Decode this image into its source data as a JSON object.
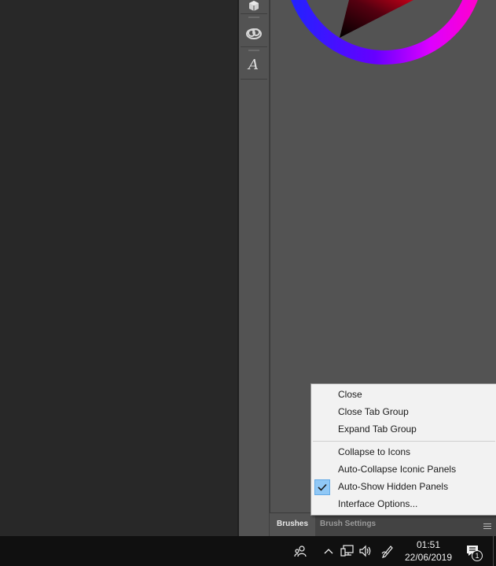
{
  "colors": {
    "canvas_bg": "#282828",
    "panel_bg": "#535353",
    "tab_inactive_bg": "#434343",
    "menu_bg": "#f2f2f2",
    "menu_check_bg": "#90c8f6",
    "taskbar_bg": "#101010"
  },
  "icon_strip": {
    "items": [
      {
        "icon": "3d-cube-icon"
      },
      {
        "icon": "creative-cloud-libraries-icon"
      },
      {
        "icon": "character-styles-icon"
      }
    ]
  },
  "color_wheel": {
    "icon": "hsb-color-wheel"
  },
  "panel_tabs": {
    "active_label": "Brushes",
    "inactive_label": "Brush Settings",
    "menu_icon": "panel-menu-icon"
  },
  "context_menu": {
    "close": "Close",
    "close_tab_group": "Close Tab Group",
    "expand_tab_group": "Expand Tab Group",
    "collapse_to_icons": "Collapse to Icons",
    "auto_collapse": "Auto-Collapse Iconic Panels",
    "auto_show": "Auto-Show Hidden Panels",
    "auto_show_checked": true,
    "interface_options": "Interface Options..."
  },
  "taskbar": {
    "time": "01:51",
    "date": "22/06/2019",
    "notification_count": "1",
    "tray_icons": [
      "people-icon",
      "chevron-up-icon",
      "network-icon",
      "volume-icon",
      "pen-workspace-icon",
      "notification-icon"
    ]
  }
}
